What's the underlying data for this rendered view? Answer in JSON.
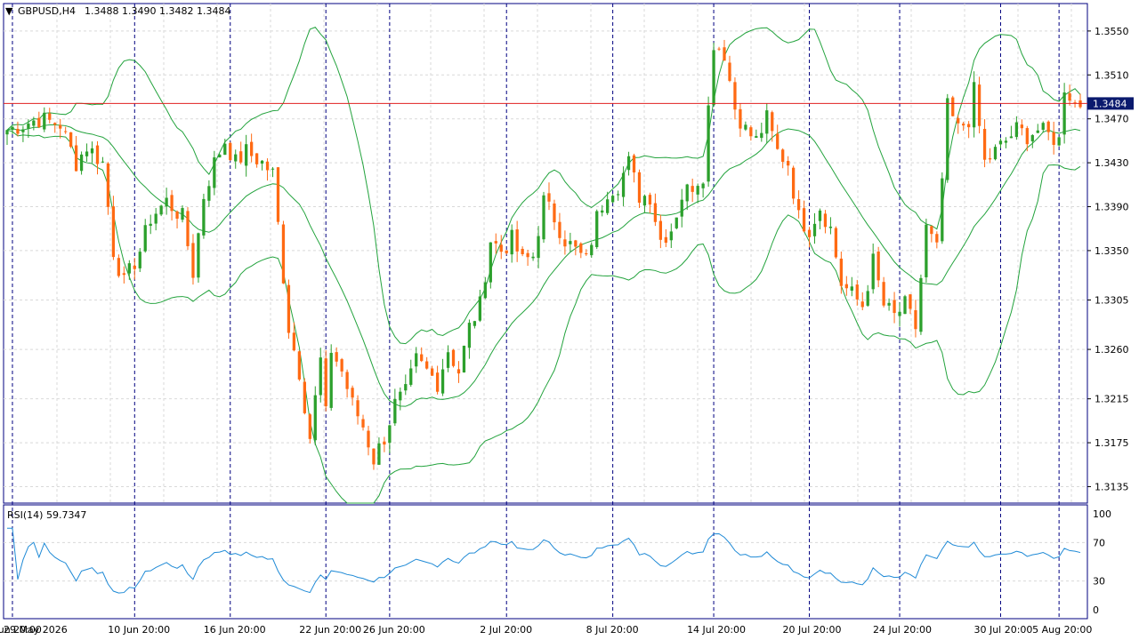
{
  "header": {
    "menu_glyph": "▼",
    "symbol_tf": "GBPUSD,H4",
    "ohlc": "1.3488 1.3490 1.3482 1.3484"
  },
  "rsi_panel": {
    "label": "RSI(14) 59.7347",
    "levels": [
      "100",
      "70",
      "30",
      "0"
    ]
  },
  "colors": {
    "bull": "#2ca02c",
    "bear": "#ff6a13",
    "bands": "#23a33d",
    "price_line": "#e02020",
    "price_tag_bg": "#0a1a6e",
    "rsi_line": "#1f8ad6",
    "grid": "#d9d9d9",
    "separators": "#000080"
  },
  "chart_data": [
    {
      "type": "candlestick",
      "symbol": "GBPUSD",
      "timeframe": "H4",
      "current_price": "1.3484",
      "price_ticks": [
        "1.3550",
        "1.3510",
        "1.3470",
        "1.3430",
        "1.3390",
        "1.3350",
        "1.3305",
        "1.3260",
        "1.3215",
        "1.3175",
        "1.3135"
      ],
      "time_labels": [
        "29 May 2026",
        "4 Jun 20:00",
        "10 Jun 20:00",
        "16 Jun 20:00",
        "22 Jun 20:00",
        "26 Jun 20:00",
        "2 Jul 20:00",
        "8 Jul 20:00",
        "14 Jul 20:00",
        "20 Jul 20:00",
        "24 Jul 20:00",
        "30 Jul 20:00",
        "5 Aug 20:00"
      ],
      "ylim": [
        1.312,
        1.3575
      ],
      "indicators": [
        "Bollinger Bands"
      ],
      "close_path": [
        [
          0,
          1.346
        ],
        [
          6,
          1.347
        ],
        [
          10,
          1.3465
        ],
        [
          13,
          1.343
        ],
        [
          15,
          1.3445
        ],
        [
          18,
          1.343
        ],
        [
          20,
          1.335
        ],
        [
          22,
          1.332
        ],
        [
          25,
          1.335
        ],
        [
          27,
          1.338
        ],
        [
          30,
          1.3395
        ],
        [
          33,
          1.338
        ],
        [
          35,
          1.333
        ],
        [
          37,
          1.34
        ],
        [
          39,
          1.343
        ],
        [
          41,
          1.345
        ],
        [
          43,
          1.343
        ],
        [
          45,
          1.344
        ],
        [
          48,
          1.343
        ],
        [
          50,
          1.342
        ],
        [
          53,
          1.328
        ],
        [
          55,
          1.324
        ],
        [
          57,
          1.318
        ],
        [
          59,
          1.325
        ],
        [
          60,
          1.32
        ],
        [
          61,
          1.326
        ],
        [
          63,
          1.324
        ],
        [
          65,
          1.321
        ],
        [
          67,
          1.319
        ],
        [
          69,
          1.316
        ],
        [
          71,
          1.318
        ],
        [
          73,
          1.321
        ],
        [
          75,
          1.322
        ],
        [
          77,
          1.325
        ],
        [
          79,
          1.324
        ],
        [
          81,
          1.323
        ],
        [
          83,
          1.326
        ],
        [
          85,
          1.324
        ],
        [
          87,
          1.328
        ],
        [
          89,
          1.33
        ],
        [
          91,
          1.336
        ],
        [
          93,
          1.335
        ],
        [
          95,
          1.336
        ],
        [
          97,
          1.334
        ],
        [
          99,
          1.3345
        ],
        [
          101,
          1.3395
        ],
        [
          103,
          1.338
        ],
        [
          105,
          1.336
        ],
        [
          107,
          1.335
        ],
        [
          109,
          1.334
        ],
        [
          111,
          1.338
        ],
        [
          113,
          1.3405
        ],
        [
          115,
          1.341
        ],
        [
          117,
          1.343
        ],
        [
          119,
          1.34
        ],
        [
          121,
          1.34
        ],
        [
          123,
          1.336
        ],
        [
          125,
          1.337
        ],
        [
          127,
          1.34
        ],
        [
          129,
          1.341
        ],
        [
          131,
          1.342
        ],
        [
          133,
          1.354
        ],
        [
          135,
          1.353
        ],
        [
          137,
          1.348
        ],
        [
          139,
          1.346
        ],
        [
          141,
          1.345
        ],
        [
          143,
          1.347
        ],
        [
          145,
          1.344
        ],
        [
          147,
          1.343
        ],
        [
          149,
          1.338
        ],
        [
          151,
          1.337
        ],
        [
          153,
          1.339
        ],
        [
          155,
          1.337
        ],
        [
          157,
          1.332
        ],
        [
          159,
          1.331
        ],
        [
          161,
          1.33
        ],
        [
          163,
          1.334
        ],
        [
          165,
          1.33
        ],
        [
          167,
          1.329
        ],
        [
          169,
          1.33
        ],
        [
          171,
          1.328
        ],
        [
          173,
          1.337
        ],
        [
          175,
          1.335
        ],
        [
          177,
          1.348
        ],
        [
          179,
          1.346
        ],
        [
          181,
          1.347
        ],
        [
          182,
          1.3495
        ],
        [
          184,
          1.343
        ],
        [
          186,
          1.344
        ],
        [
          188,
          1.345
        ],
        [
          190,
          1.346
        ],
        [
          192,
          1.3455
        ],
        [
          194,
          1.346
        ],
        [
          196,
          1.3455
        ],
        [
          198,
          1.345
        ],
        [
          199,
          1.35
        ],
        [
          201,
          1.3484
        ]
      ]
    },
    {
      "type": "line",
      "name": "RSI(14)",
      "value_label": "59.7347",
      "ylim": [
        0,
        100
      ],
      "levels": [
        30,
        70
      ]
    }
  ]
}
